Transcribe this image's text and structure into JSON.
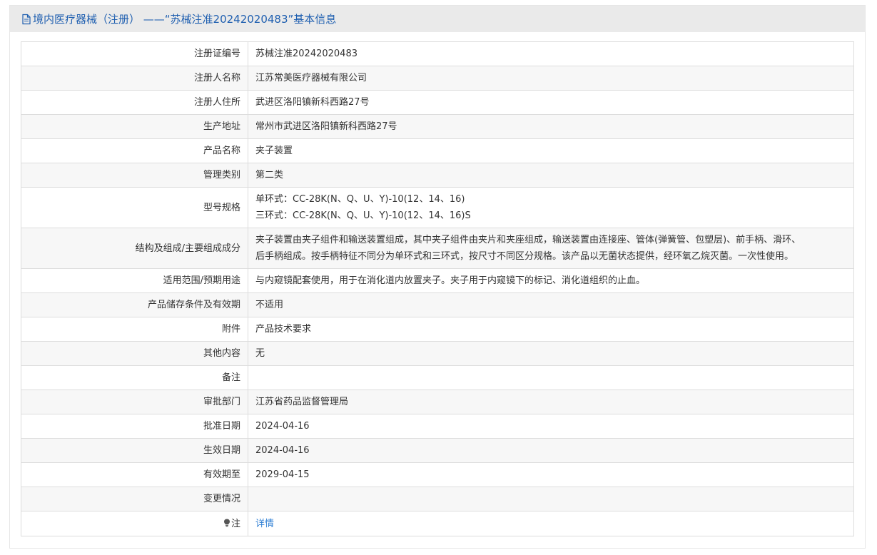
{
  "header": {
    "title": "境内医疗器械（注册） ——“苏械注准20242020483”基本信息",
    "icon": "document-icon"
  },
  "rows": [
    {
      "label": "注册证编号",
      "value": "苏械注准20242020483"
    },
    {
      "label": "注册人名称",
      "value": "江苏常美医疗器械有限公司"
    },
    {
      "label": "注册人住所",
      "value": "武进区洛阳镇新科西路27号"
    },
    {
      "label": "生产地址",
      "value": "常州市武进区洛阳镇新科西路27号"
    },
    {
      "label": "产品名称",
      "value": "夹子装置"
    },
    {
      "label": "管理类别",
      "value": "第二类"
    },
    {
      "label": "型号规格",
      "lines": [
        "单环式：CC-28K(N、Q、U、Y)-10(12、14、16)",
        "三环式：CC-28K(N、Q、U、Y)-10(12、14、16)S"
      ]
    },
    {
      "label": "结构及组成/主要组成成分",
      "lines": [
        "夹子装置由夹子组件和输送装置组成，其中夹子组件由夹片和夹座组成，输送装置由连接座、管体(弹簧管、包塑层)、前手柄、滑环、",
        "后手柄组成。按手柄特征不同分为单环式和三环式，按尺寸不同区分规格。该产品以无菌状态提供，经环氧乙烷灭菌。一次性使用。"
      ]
    },
    {
      "label": "适用范围/预期用途",
      "value": "与内窥镜配套使用，用于在消化道内放置夹子。夹子用于内窥镜下的标记、消化道组织的止血。"
    },
    {
      "label": "产品储存条件及有效期",
      "value": "不适用"
    },
    {
      "label": "附件",
      "value": "产品技术要求"
    },
    {
      "label": "其他内容",
      "value": "无"
    },
    {
      "label": "备注",
      "value": ""
    },
    {
      "label": "审批部门",
      "value": "江苏省药品监督管理局"
    },
    {
      "label": "批准日期",
      "value": "2024-04-16"
    },
    {
      "label": "生效日期",
      "value": "2024-04-16"
    },
    {
      "label": "有效期至",
      "value": "2029-04-15"
    },
    {
      "label": "变更情况",
      "value": ""
    }
  ],
  "note": {
    "label": "注",
    "icon": "lightbulb-icon",
    "link_text": "详情"
  },
  "colors": {
    "header_text": "#1f5fb0",
    "link": "#2f7fd4",
    "header_bg": "#eaeaea",
    "border": "#dddddd",
    "stripe": "#f7f7f7"
  }
}
